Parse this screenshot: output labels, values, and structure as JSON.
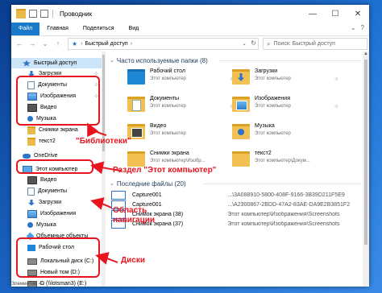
{
  "window": {
    "title": "Проводник",
    "buttons": {
      "minimize": "—",
      "maximize": "☐",
      "close": "✕"
    }
  },
  "ribbon": {
    "tabs": [
      "Файл",
      "Главная",
      "Поделиться",
      "Вид"
    ],
    "expand_glyph": "⌄",
    "help_glyph": "?"
  },
  "address": {
    "back": "←",
    "forward": "→",
    "up_history": "⌄",
    "up": "↑",
    "path": "Быстрый доступ",
    "separator": "›",
    "dropdown": "⌄",
    "refresh": "↻",
    "search_placeholder": "Поиск: Быстрый доступ"
  },
  "nav": {
    "items": [
      {
        "label": "Быстрый доступ",
        "icon": "star-icon",
        "pinned": false
      },
      {
        "label": "Загрузки",
        "icon": "download-icon",
        "pinned": true
      },
      {
        "label": "Документы",
        "icon": "document-icon",
        "pinned": true
      },
      {
        "label": "Изображения",
        "icon": "pictures-icon",
        "pinned": true
      },
      {
        "label": "Видео",
        "icon": "video-icon",
        "pinned": false
      },
      {
        "label": "Музыка",
        "icon": "music-icon",
        "pinned": false
      },
      {
        "label": "Снимки экрана",
        "icon": "folder-icon",
        "pinned": false
      },
      {
        "label": "текст2",
        "icon": "folder-icon",
        "pinned": false
      },
      {
        "label": "OneDrive",
        "icon": "cloud-icon",
        "pinned": false
      },
      {
        "label": "Этот компьютер",
        "icon": "computer-icon",
        "pinned": false
      },
      {
        "label": "Видео",
        "icon": "video-icon",
        "pinned": false
      },
      {
        "label": "Документы",
        "icon": "document-icon",
        "pinned": false
      },
      {
        "label": "Загрузки",
        "icon": "download-icon",
        "pinned": false
      },
      {
        "label": "Изображения",
        "icon": "pictures-icon",
        "pinned": false
      },
      {
        "label": "Музыка",
        "icon": "music-icon",
        "pinned": false
      },
      {
        "label": "Объемные объекты",
        "icon": "3d-objects-icon",
        "pinned": false
      },
      {
        "label": "Рабочий стол",
        "icon": "desktop-icon",
        "pinned": false
      },
      {
        "label": "Локальный диск (C:)",
        "icon": "drive-icon",
        "pinned": false
      },
      {
        "label": "Новый том (D:)",
        "icon": "drive-icon",
        "pinned": false
      },
      {
        "label": "D (\\\\lotsman3) (E:)",
        "icon": "network-drive-icon",
        "pinned": false
      }
    ],
    "pin_glyph": "⊹",
    "expand_glyph": "›"
  },
  "main": {
    "frequent_header": "Часто используемые папки (8)",
    "recent_header": "Последние файлы (20)",
    "folders": [
      {
        "name": "Рабочий стол",
        "sub": "Этот компьютер"
      },
      {
        "name": "Загрузки",
        "sub": "Этот компьютер"
      },
      {
        "name": "Документы",
        "sub": "Этот компьютер"
      },
      {
        "name": "Изображения",
        "sub": "Этот компьютер"
      },
      {
        "name": "Видео",
        "sub": "Этот компьютер"
      },
      {
        "name": "Музыка",
        "sub": "Этот компьютер"
      },
      {
        "name": "Снимки экрана",
        "sub": "Этот компьютер\\Изобр..."
      },
      {
        "name": "текст2",
        "sub": "Этот компьютер\\Докум..."
      }
    ],
    "files": [
      {
        "name": "Capture001",
        "path": "...\\3A088910-5800-408F-9166-3B39D211F5E9"
      },
      {
        "name": "Capture001",
        "path": "...\\A2300867-2BDD-47A2-83AE-DA9E2B3851F2"
      },
      {
        "name": "Снимок экрана (38)",
        "path": "Этот компьютер\\Изображения\\Screenshots"
      },
      {
        "name": "Снимок экрана (37)",
        "path": "Этот компьютер\\Изображения\\Screenshots"
      }
    ]
  },
  "status": {
    "text": "Элементов: 42"
  },
  "annotations": {
    "libraries": "\"Библиотеки\"",
    "this_pc": "Раздел \"Этот компьютер\"",
    "nav_area_line1": "Область",
    "nav_area_line2": "навигации",
    "disks": "Диски"
  },
  "colors": {
    "annotation": "#e8141e",
    "accent": "#1979ca",
    "selected": "#cce4f7"
  }
}
